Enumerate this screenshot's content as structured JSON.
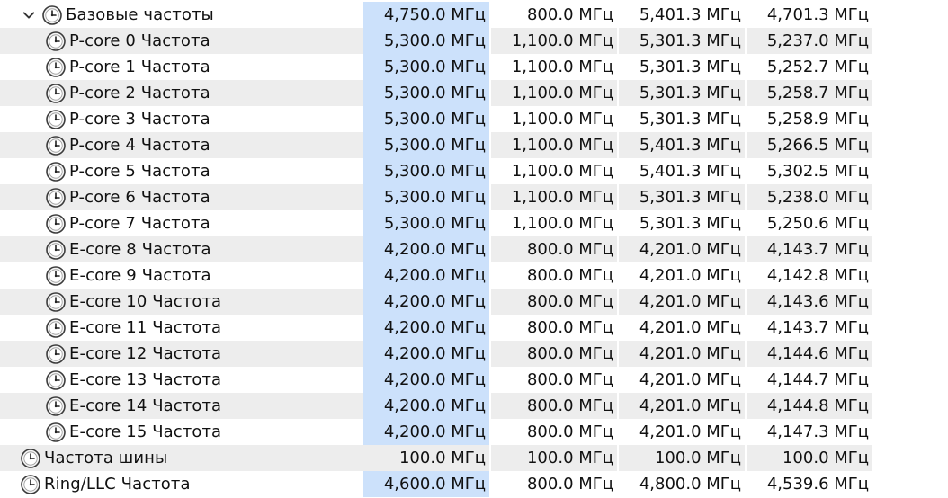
{
  "unit": "МГц",
  "colors": {
    "row_alt": "#ededed",
    "current_highlight": "#cce1fb",
    "text": "#111111"
  },
  "icons": {
    "sensor": "clock-icon",
    "expander": "chevron-down-icon"
  },
  "rows": [
    {
      "label": "Базовые частоты",
      "current": "4,750.0 МГц",
      "min": "800.0 МГц",
      "max": "5,401.3 МГц",
      "avg": "4,701.3 МГц",
      "expanded": true,
      "highlight": true
    },
    {
      "label": "P-core 0 Частота",
      "current": "5,300.0 МГц",
      "min": "1,100.0 МГц",
      "max": "5,301.3 МГц",
      "avg": "5,237.0 МГц",
      "child": true,
      "highlight": true
    },
    {
      "label": "P-core 1 Частота",
      "current": "5,300.0 МГц",
      "min": "1,100.0 МГц",
      "max": "5,301.3 МГц",
      "avg": "5,252.7 МГц",
      "child": true,
      "highlight": true
    },
    {
      "label": "P-core 2 Частота",
      "current": "5,300.0 МГц",
      "min": "1,100.0 МГц",
      "max": "5,301.3 МГц",
      "avg": "5,258.7 МГц",
      "child": true,
      "highlight": true
    },
    {
      "label": "P-core 3 Частота",
      "current": "5,300.0 МГц",
      "min": "1,100.0 МГц",
      "max": "5,301.3 МГц",
      "avg": "5,258.9 МГц",
      "child": true,
      "highlight": true
    },
    {
      "label": "P-core 4 Частота",
      "current": "5,300.0 МГц",
      "min": "1,100.0 МГц",
      "max": "5,401.3 МГц",
      "avg": "5,266.5 МГц",
      "child": true,
      "highlight": true
    },
    {
      "label": "P-core 5 Частота",
      "current": "5,300.0 МГц",
      "min": "1,100.0 МГц",
      "max": "5,401.3 МГц",
      "avg": "5,302.5 МГц",
      "child": true,
      "highlight": true
    },
    {
      "label": "P-core 6 Частота",
      "current": "5,300.0 МГц",
      "min": "1,100.0 МГц",
      "max": "5,301.3 МГц",
      "avg": "5,238.0 МГц",
      "child": true,
      "highlight": true
    },
    {
      "label": "P-core 7 Частота",
      "current": "5,300.0 МГц",
      "min": "1,100.0 МГц",
      "max": "5,301.3 МГц",
      "avg": "5,250.6 МГц",
      "child": true,
      "highlight": true
    },
    {
      "label": "E-core 8 Частота",
      "current": "4,200.0 МГц",
      "min": "800.0 МГц",
      "max": "4,201.0 МГц",
      "avg": "4,143.7 МГц",
      "child": true,
      "highlight": true
    },
    {
      "label": "E-core 9 Частота",
      "current": "4,200.0 МГц",
      "min": "800.0 МГц",
      "max": "4,201.0 МГц",
      "avg": "4,142.8 МГц",
      "child": true,
      "highlight": true
    },
    {
      "label": "E-core 10 Частота",
      "current": "4,200.0 МГц",
      "min": "800.0 МГц",
      "max": "4,201.0 МГц",
      "avg": "4,143.6 МГц",
      "child": true,
      "highlight": true
    },
    {
      "label": "E-core 11 Частота",
      "current": "4,200.0 МГц",
      "min": "800.0 МГц",
      "max": "4,201.0 МГц",
      "avg": "4,143.7 МГц",
      "child": true,
      "highlight": true
    },
    {
      "label": "E-core 12 Частота",
      "current": "4,200.0 МГц",
      "min": "800.0 МГц",
      "max": "4,201.0 МГц",
      "avg": "4,144.6 МГц",
      "child": true,
      "highlight": true
    },
    {
      "label": "E-core 13 Частота",
      "current": "4,200.0 МГц",
      "min": "800.0 МГц",
      "max": "4,201.0 МГц",
      "avg": "4,144.7 МГц",
      "child": true,
      "highlight": true
    },
    {
      "label": "E-core 14 Частота",
      "current": "4,200.0 МГц",
      "min": "800.0 МГц",
      "max": "4,201.0 МГц",
      "avg": "4,144.8 МГц",
      "child": true,
      "highlight": true
    },
    {
      "label": "E-core 15 Частота",
      "current": "4,200.0 МГц",
      "min": "800.0 МГц",
      "max": "4,201.0 МГц",
      "avg": "4,147.3 МГц",
      "child": true,
      "highlight": true
    },
    {
      "label": "Частота шины",
      "current": "100.0 МГц",
      "min": "100.0 МГц",
      "max": "100.0 МГц",
      "avg": "100.0 МГц",
      "highlight": false
    },
    {
      "label": "Ring/LLC Частота",
      "current": "4,600.0 МГц",
      "min": "800.0 МГц",
      "max": "4,800.0 МГц",
      "avg": "4,539.6 МГц",
      "highlight": true
    }
  ]
}
